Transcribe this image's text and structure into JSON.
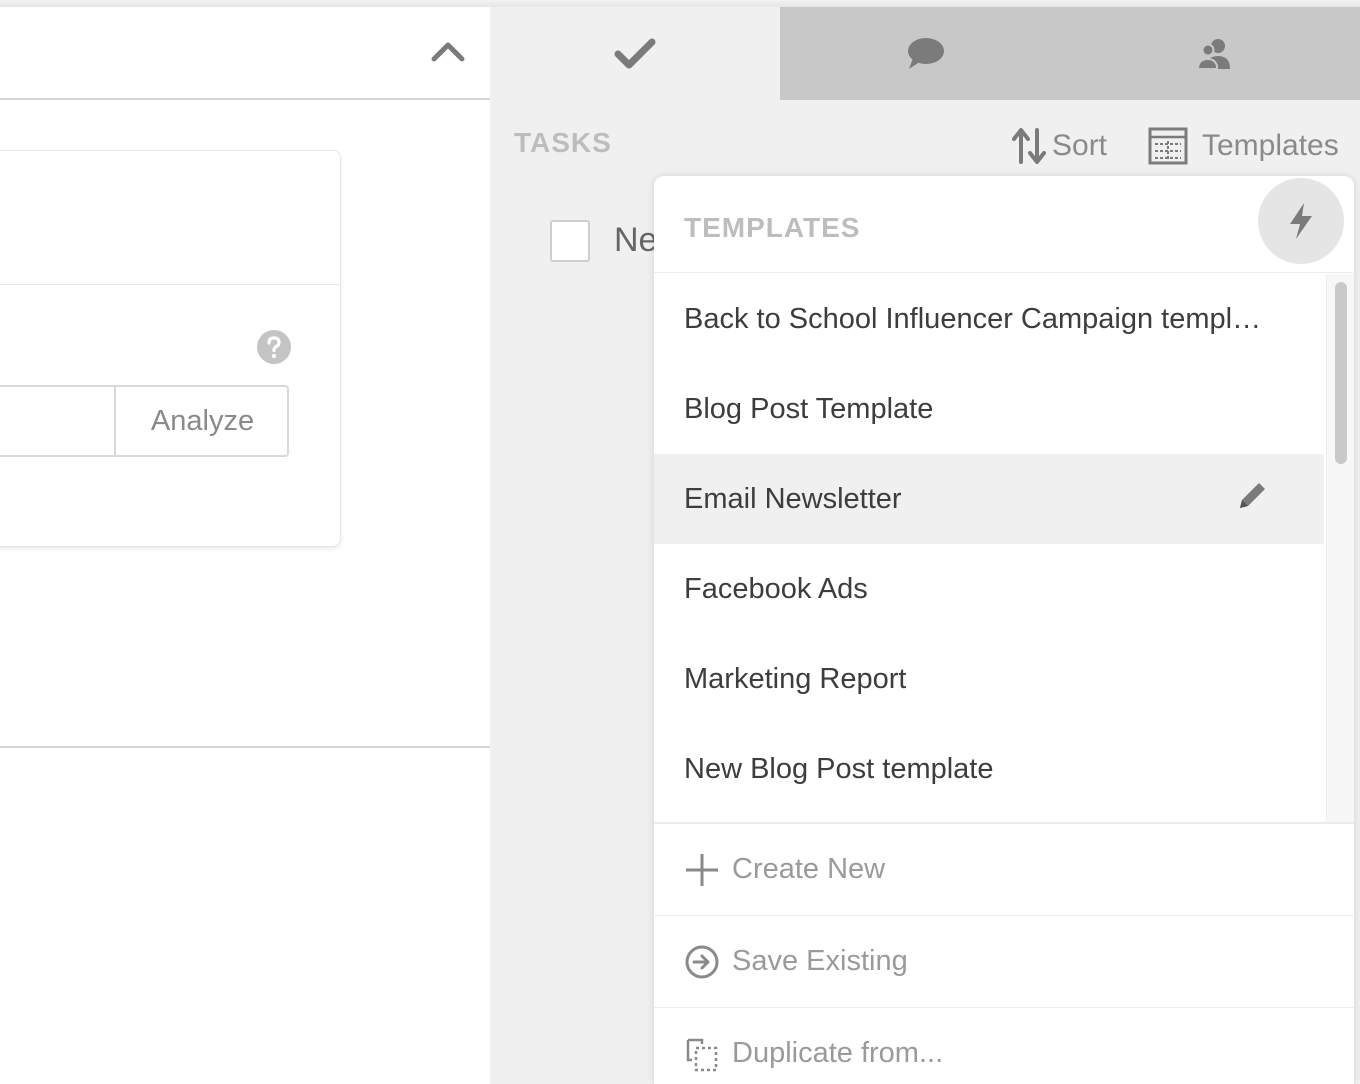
{
  "left": {
    "analyze_label": "Analyze"
  },
  "tabs": [
    {
      "name": "tasks",
      "icon": "checkmark-icon",
      "active": true
    },
    {
      "name": "comments",
      "icon": "chat-bubble-icon",
      "active": false
    },
    {
      "name": "people",
      "icon": "users-icon",
      "active": false
    }
  ],
  "tasks": {
    "label": "TASKS",
    "sort_label": "Sort",
    "templates_label": "Templates",
    "first_task_text": "Ne"
  },
  "templates_dropdown": {
    "title": "TEMPLATES",
    "items": [
      {
        "label": "Back to School Influencer Campaign templ…"
      },
      {
        "label": "Blog Post Template"
      },
      {
        "label": "Email Newsletter"
      },
      {
        "label": "Facebook Ads"
      },
      {
        "label": "Marketing Report"
      },
      {
        "label": "New Blog Post template"
      }
    ],
    "actions": {
      "create_new": "Create New",
      "save_existing": "Save Existing",
      "duplicate_from": "Duplicate from..."
    }
  },
  "colors": {
    "panel_bg": "#f0f0f0",
    "inactive_tab": "#c8c8c8",
    "muted_text": "#9a9a9a",
    "hover_row": "#f0f0f0"
  }
}
